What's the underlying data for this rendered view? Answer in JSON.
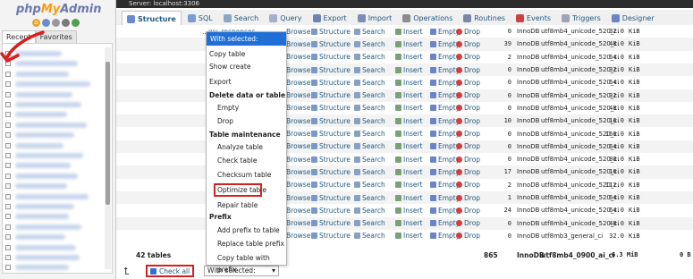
{
  "app": {
    "logo_php": "php",
    "logo_my": "My",
    "logo_admin": "Admin"
  },
  "left_tabs": [
    "Recent",
    "Favorites"
  ],
  "server_bar": "Server: localhost:3306",
  "top_menu": [
    {
      "label": "Structure",
      "icon": "structure-icon",
      "color": "#6a8ad1",
      "active": true
    },
    {
      "label": "SQL",
      "icon": "sql-icon",
      "color": "#7a9bd6",
      "active": false
    },
    {
      "label": "Search",
      "icon": "search-icon",
      "color": "#8aa6c8",
      "active": false
    },
    {
      "label": "Query",
      "icon": "query-icon",
      "color": "#9fb0c8",
      "active": false
    },
    {
      "label": "Export",
      "icon": "export-icon",
      "color": "#6b84b4",
      "active": false
    },
    {
      "label": "Import",
      "icon": "import-icon",
      "color": "#7c8eb8",
      "active": false
    },
    {
      "label": "Operations",
      "icon": "operations-icon",
      "color": "#8b8b8b",
      "active": false
    },
    {
      "label": "Routines",
      "icon": "routines-icon",
      "color": "#7a88a8",
      "active": false
    },
    {
      "label": "Events",
      "icon": "events-icon",
      "color": "#d04040",
      "active": false
    },
    {
      "label": "Triggers",
      "icon": "triggers-icon",
      "color": "#9aa6b8",
      "active": false
    },
    {
      "label": "Designer",
      "icon": "designer-icon",
      "color": "#6a84c4",
      "active": false
    }
  ],
  "row_actions": [
    "Browse",
    "Structure",
    "Search",
    "Insert",
    "Empty",
    "Drop"
  ],
  "first_row_name": "...wy_responses",
  "rows": [
    {
      "rows": "0",
      "engine": "InnoDB",
      "collation": "utf8mb4_unicode_520_ci",
      "size": "32.0",
      "unit": "KiB"
    },
    {
      "rows": "39",
      "engine": "InnoDB",
      "collation": "utf8mb4_unicode_520_ci",
      "size": "48.0",
      "unit": "KiB"
    },
    {
      "rows": "2",
      "engine": "InnoDB",
      "collation": "utf8mb4_unicode_520_ci",
      "size": "64.0",
      "unit": "KiB"
    },
    {
      "rows": "0",
      "engine": "InnoDB",
      "collation": "utf8mb4_unicode_520_ci",
      "size": "32.0",
      "unit": "KiB"
    },
    {
      "rows": "0",
      "engine": "InnoDB",
      "collation": "utf8mb4_unicode_520_ci",
      "size": "64.0",
      "unit": "KiB"
    },
    {
      "rows": "0",
      "engine": "InnoDB",
      "collation": "utf8mb4_unicode_520_ci",
      "size": "32.0",
      "unit": "KiB"
    },
    {
      "rows": "0",
      "engine": "InnoDB",
      "collation": "utf8mb4_unicode_520_ci",
      "size": "48.0",
      "unit": "KiB"
    },
    {
      "rows": "10",
      "engine": "InnoDB",
      "collation": "utf8mb4_unicode_520_ci",
      "size": "16.0",
      "unit": "KiB"
    },
    {
      "rows": "0",
      "engine": "InnoDB",
      "collation": "utf8mb4_unicode_520_ci",
      "size": "160.0",
      "unit": "KiB"
    },
    {
      "rows": "0",
      "engine": "InnoDB",
      "collation": "utf8mb4_unicode_520_ci",
      "size": "64.0",
      "unit": "KiB"
    },
    {
      "rows": "0",
      "engine": "InnoDB",
      "collation": "utf8mb4_unicode_520_ci",
      "size": "80.0",
      "unit": "KiB"
    },
    {
      "rows": "17",
      "engine": "InnoDB",
      "collation": "utf8mb4_unicode_520_ci",
      "size": "16.0",
      "unit": "KiB"
    },
    {
      "rows": "2",
      "engine": "InnoDB",
      "collation": "utf8mb4_unicode_520_ci",
      "size": "112.0",
      "unit": "KiB"
    },
    {
      "rows": "1",
      "engine": "InnoDB",
      "collation": "utf8mb4_unicode_520_ci",
      "size": "64.0",
      "unit": "KiB"
    },
    {
      "rows": "24",
      "engine": "InnoDB",
      "collation": "utf8mb4_unicode_520_ci",
      "size": "64.0",
      "unit": "KiB"
    },
    {
      "rows": "0",
      "engine": "InnoDB",
      "collation": "utf8mb4_unicode_520_ci",
      "size": "48.0",
      "unit": "KiB"
    },
    {
      "rows": "0",
      "engine": "InnoDB",
      "collation": "utf8mb3_general_ci",
      "size": "32.0",
      "unit": "KiB"
    }
  ],
  "footer": {
    "tables": "42 tables",
    "rows": "865",
    "engine": "InnoDB",
    "collation": "utf8mb4_0900_ai_ci",
    "size": "6.3 MiB",
    "overhead": "0 B"
  },
  "bottom": {
    "check_all": "Check all",
    "with_selected": "With selected:"
  },
  "dropdown": {
    "header": "With selected:",
    "items": [
      {
        "label": "Copy table",
        "type": "top"
      },
      {
        "label": "Show create",
        "type": "top"
      },
      {
        "label": "Export",
        "type": "top"
      },
      {
        "label": "Delete data or table",
        "type": "grp"
      },
      {
        "label": "Empty",
        "type": "sub"
      },
      {
        "label": "Drop",
        "type": "sub"
      },
      {
        "label": "Table maintenance",
        "type": "grp"
      },
      {
        "label": "Analyze table",
        "type": "sub"
      },
      {
        "label": "Check table",
        "type": "sub"
      },
      {
        "label": "Checksum table",
        "type": "sub"
      },
      {
        "label": "Optimize table",
        "type": "sub"
      },
      {
        "label": "Repair table",
        "type": "sub"
      },
      {
        "label": "Prefix",
        "type": "grp"
      },
      {
        "label": "Add prefix to table",
        "type": "sub"
      },
      {
        "label": "Replace table prefix",
        "type": "sub"
      },
      {
        "label": "Copy table with prefix",
        "type": "sub"
      }
    ]
  },
  "colors": {
    "accent": "#1f6fd6",
    "link": "#235a81",
    "highlight": "#d81f1f"
  }
}
